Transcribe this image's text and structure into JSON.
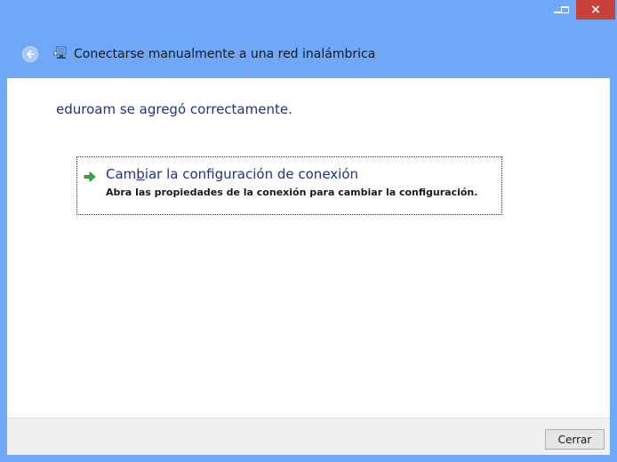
{
  "window": {
    "minimize_icon": "minimize-icon",
    "maximize_icon": "maximize-icon",
    "close_glyph": "×"
  },
  "header": {
    "title": "Conectarse manualmente a una red inalámbrica",
    "back_icon": "back-arrow-icon",
    "network_icon": "network-icon"
  },
  "main": {
    "success_message": "eduroam se agregó correctamente.",
    "option": {
      "title_pre": "Cam",
      "title_accel": "b",
      "title_post": "iar la configuración de conexión",
      "description": "Abra las propiedades de la conexión para cambiar la configuración.",
      "icon": "green-arrow-icon"
    }
  },
  "footer": {
    "close_label": "Cerrar"
  },
  "colors": {
    "frame": "#6ea8f7",
    "close_button_red": "#c7413a",
    "link_blue": "#1e3287",
    "footer_bg": "#f0f0f0"
  }
}
